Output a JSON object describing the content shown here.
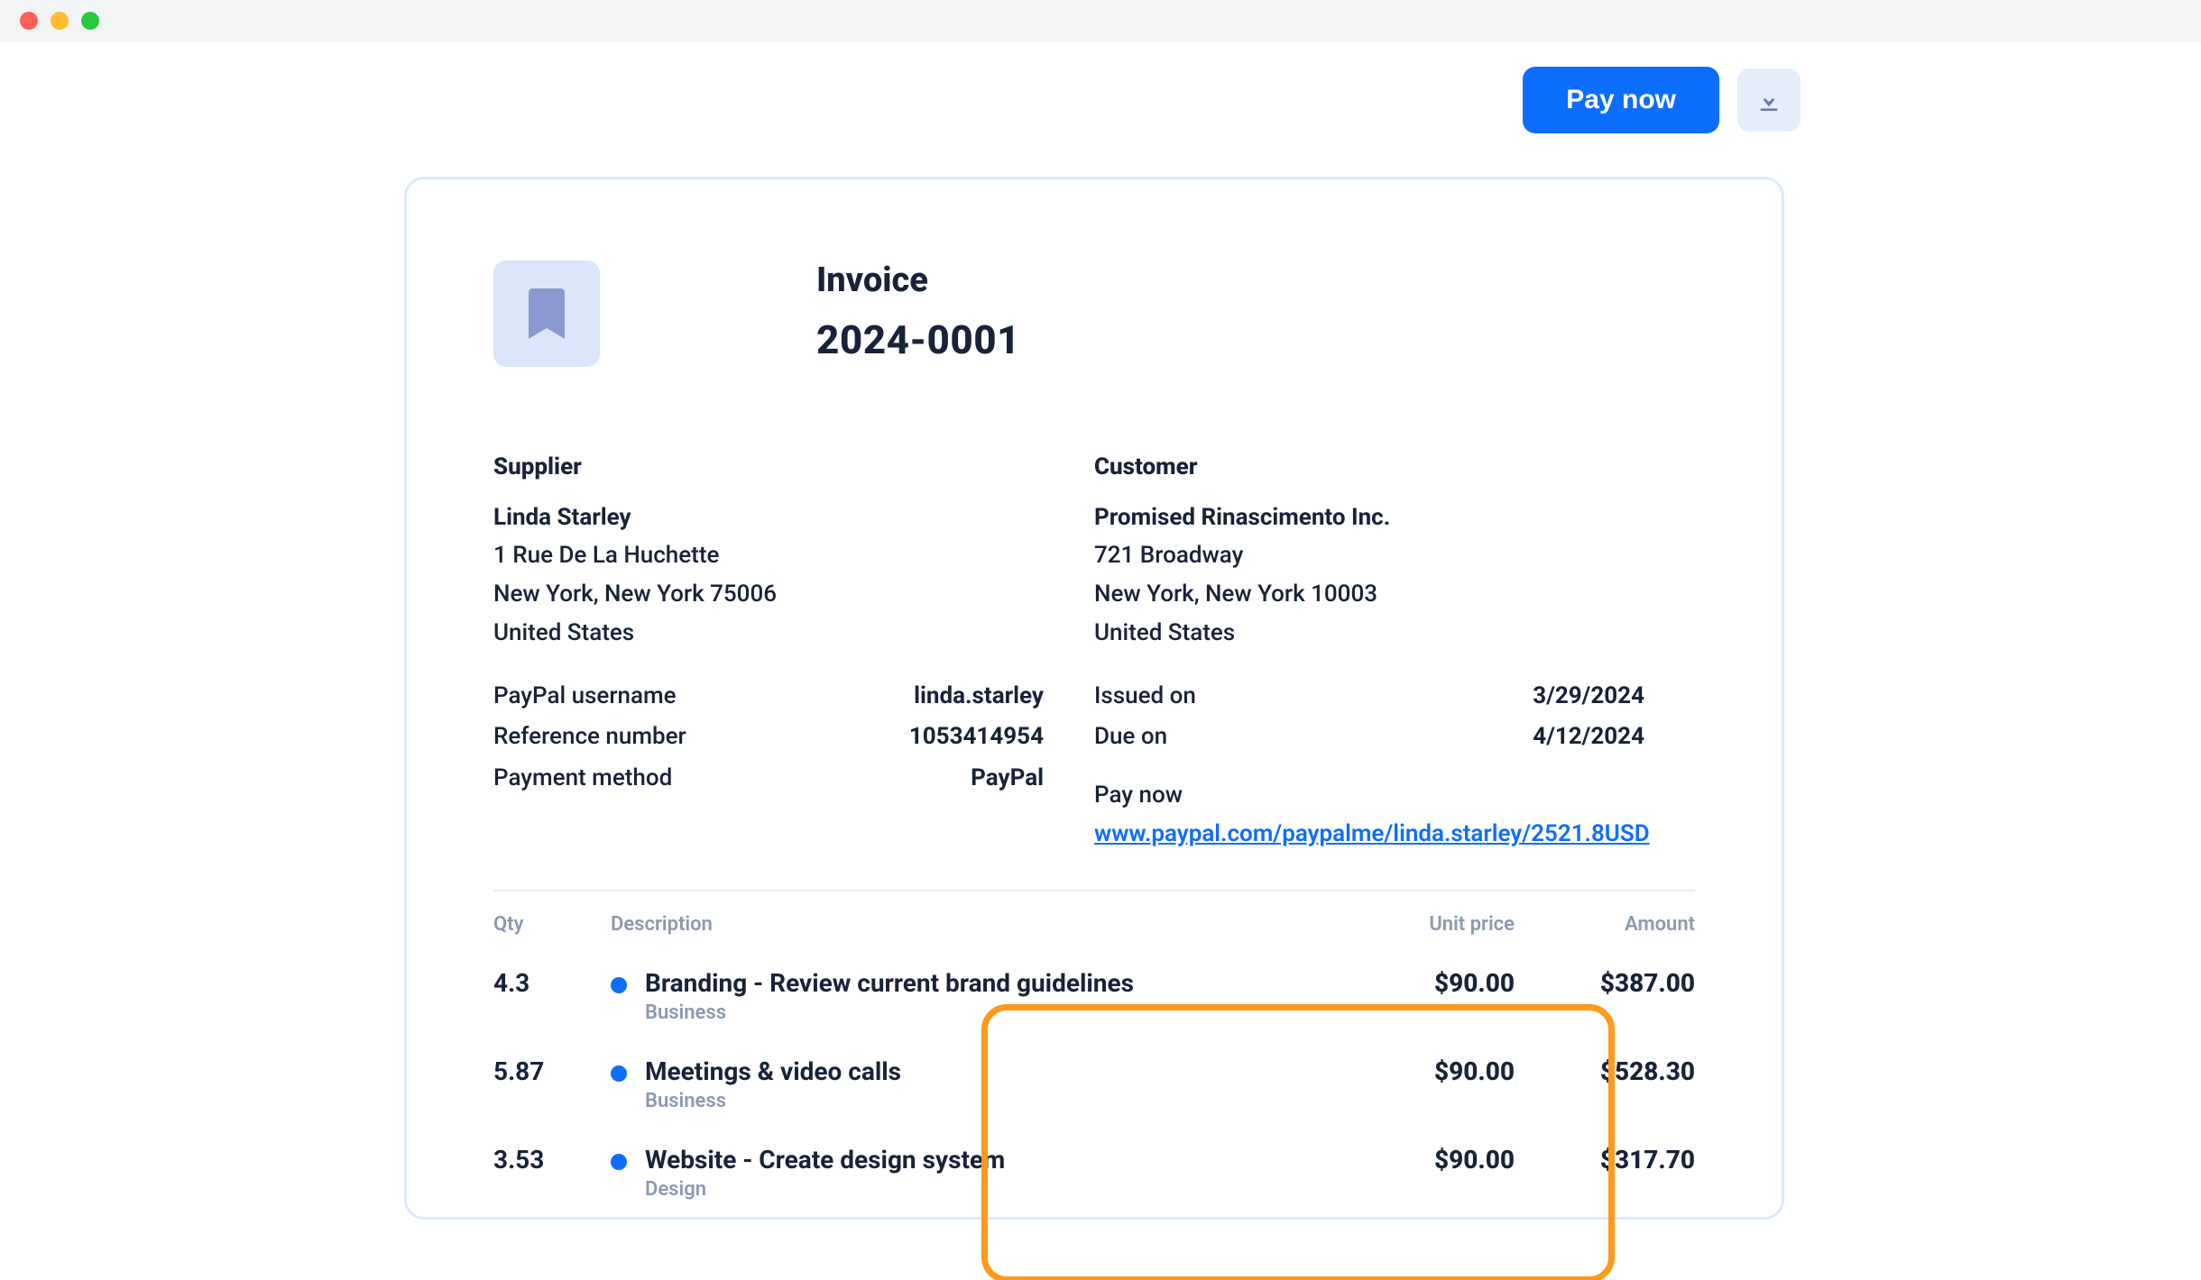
{
  "actions": {
    "pay_label": "Pay now"
  },
  "invoice": {
    "label": "Invoice",
    "number": "2024-0001"
  },
  "supplier": {
    "heading": "Supplier",
    "name": "Linda Starley",
    "address1": "1 Rue De La Huchette",
    "address2": "New York, New York 75006",
    "country": "United States",
    "fields": {
      "paypal_user_label": "PayPal username",
      "paypal_user_value": "linda.starley",
      "ref_label": "Reference number",
      "ref_value": "1053414954",
      "method_label": "Payment method",
      "method_value": "PayPal"
    }
  },
  "customer": {
    "heading": "Customer",
    "name": "Promised Rinascimento Inc.",
    "address1": "721 Broadway",
    "address2": "New York, New York 10003",
    "country": "United States",
    "fields": {
      "issued_label": "Issued on",
      "issued_value": "3/29/2024",
      "due_label": "Due on",
      "due_value": "4/12/2024"
    },
    "paynow_label": "Pay now",
    "paynow_link": "www.paypal.com/paypalme/linda.starley/2521.8USD"
  },
  "table": {
    "headers": {
      "qty": "Qty",
      "desc": "Description",
      "unit": "Unit price",
      "amount": "Amount"
    },
    "rows": [
      {
        "qty": "4.3",
        "title": "Branding - Review current brand guidelines",
        "category": "Business",
        "unit": "$90.00",
        "amount": "$387.00",
        "dot": "#0d6efd"
      },
      {
        "qty": "5.87",
        "title": "Meetings & video calls",
        "category": "Business",
        "unit": "$90.00",
        "amount": "$528.30",
        "dot": "#0d6efd"
      },
      {
        "qty": "3.53",
        "title": "Website - Create design system",
        "category": "Design",
        "unit": "$90.00",
        "amount": "$317.70",
        "dot": "#0d6efd"
      }
    ]
  }
}
